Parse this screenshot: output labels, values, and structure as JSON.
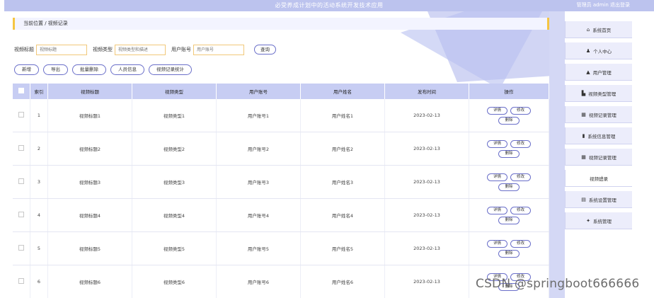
{
  "topbar": {
    "title": "必受养成计划中的活动系统开发技术应用",
    "user": "管理员 admin 退出登录"
  },
  "breadcrumb": "当前位置 / 视频记录",
  "search": {
    "fields": [
      {
        "label": "视频标题",
        "placeholder": "视频标题"
      },
      {
        "label": "视频类型",
        "placeholder": "视频类型和描述"
      },
      {
        "label": "用户账号",
        "placeholder": "用户账号"
      }
    ],
    "button": "查询"
  },
  "actions": [
    "新增",
    "导出",
    "批量删除",
    "人员信息",
    "视频记录统计"
  ],
  "table": {
    "headers": [
      "索引",
      "视频标题",
      "视频类型",
      "用户账号",
      "用户姓名",
      "发布时间",
      "操作"
    ],
    "rows": [
      {
        "idx": "1",
        "title": "视频标题1",
        "type": "视频类型1",
        "account": "用户账号1",
        "name": "用户姓名1",
        "date": "2023-02-13"
      },
      {
        "idx": "2",
        "title": "视频标题2",
        "type": "视频类型2",
        "account": "用户账号2",
        "name": "用户姓名2",
        "date": "2023-02-13"
      },
      {
        "idx": "3",
        "title": "视频标题3",
        "type": "视频类型3",
        "account": "用户账号3",
        "name": "用户姓名3",
        "date": "2023-02-13"
      },
      {
        "idx": "4",
        "title": "视频标题4",
        "type": "视频类型4",
        "account": "用户账号4",
        "name": "用户姓名4",
        "date": "2023-02-13"
      },
      {
        "idx": "5",
        "title": "视频标题5",
        "type": "视频类型5",
        "account": "用户账号5",
        "name": "用户姓名5",
        "date": "2023-02-13"
      },
      {
        "idx": "6",
        "title": "视频标题6",
        "type": "视频类型6",
        "account": "用户账号6",
        "name": "用户姓名6",
        "date": "2023-02-13"
      }
    ],
    "row_ops": [
      "详情",
      "修改",
      "删除"
    ]
  },
  "sidebar": {
    "items": [
      {
        "icon": "home-icon",
        "glyph": "⌂",
        "label": "系统首页"
      },
      {
        "icon": "user-icon",
        "glyph": "♟",
        "label": "个人中心"
      },
      {
        "icon": "lock-icon",
        "glyph": "▲",
        "label": "用户管理"
      },
      {
        "icon": "cart-icon",
        "glyph": "▙",
        "label": "视频类型管理"
      },
      {
        "icon": "grid-icon",
        "glyph": "▦",
        "label": "视频记录管理"
      },
      {
        "icon": "trash-icon",
        "glyph": "▮",
        "label": "系统信息管理"
      },
      {
        "icon": "grid-icon",
        "glyph": "▦",
        "label": "视频记录管理"
      },
      {
        "icon": "none",
        "glyph": "",
        "label": "视频记录"
      },
      {
        "icon": "list-icon",
        "glyph": "▤",
        "label": "系统设置管理"
      },
      {
        "icon": "pin-icon",
        "glyph": "✦",
        "label": "系统管理"
      }
    ]
  },
  "watermark": "CSDN @springboot666666",
  "colors": {
    "accent": "#6a6fc9",
    "header": "#bcc3ee",
    "table_header": "#c7cdf3",
    "highlight": "#f5c542"
  }
}
